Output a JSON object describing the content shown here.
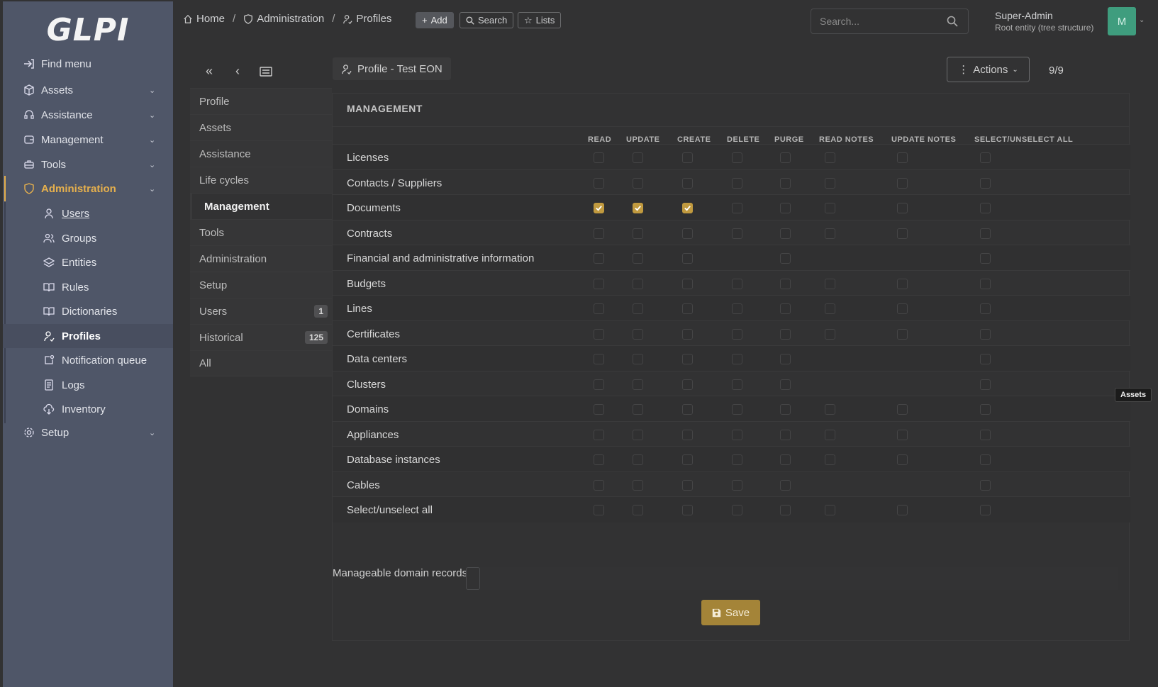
{
  "sidebar": {
    "logo": "GLPI",
    "items": [
      {
        "label": "Find menu",
        "icon": "find-menu-icon",
        "has_chevron": false
      },
      {
        "label": "Assets",
        "icon": "box-icon",
        "has_chevron": true
      },
      {
        "label": "Assistance",
        "icon": "headset-icon",
        "has_chevron": true
      },
      {
        "label": "Management",
        "icon": "wallet-icon",
        "has_chevron": true
      },
      {
        "label": "Tools",
        "icon": "briefcase-icon",
        "has_chevron": true
      },
      {
        "label": "Administration",
        "icon": "shield-icon",
        "has_chevron": true,
        "active": true
      }
    ],
    "admin_items": [
      {
        "label": "Users",
        "icon": "user-icon"
      },
      {
        "label": "Groups",
        "icon": "users-icon"
      },
      {
        "label": "Entities",
        "icon": "stack-icon"
      },
      {
        "label": "Rules",
        "icon": "book-icon"
      },
      {
        "label": "Dictionaries",
        "icon": "book-icon"
      },
      {
        "label": "Profiles",
        "icon": "user-check-icon",
        "active": true
      },
      {
        "label": "Notification queue",
        "icon": "notification-icon"
      },
      {
        "label": "Logs",
        "icon": "log-icon"
      },
      {
        "label": "Inventory",
        "icon": "cloud-download-icon"
      }
    ],
    "setup": {
      "label": "Setup",
      "icon": "gear-icon"
    }
  },
  "topbar": {
    "breadcrumbs": [
      "Home",
      "Administration",
      "Profiles"
    ],
    "add_label": "Add",
    "search_label": "Search",
    "lists_label": "Lists",
    "search_placeholder": "Search...",
    "user_name": "Super-Admin",
    "user_entity": "Root entity (tree structure)",
    "avatar_initial": "M"
  },
  "profile": {
    "title": "Profile - Test EON",
    "actions_label": "Actions",
    "pager": "9/9"
  },
  "tabs": [
    {
      "label": "Profile"
    },
    {
      "label": "Assets"
    },
    {
      "label": "Assistance"
    },
    {
      "label": "Life cycles"
    },
    {
      "label": "Management",
      "active": true
    },
    {
      "label": "Tools"
    },
    {
      "label": "Administration"
    },
    {
      "label": "Setup"
    },
    {
      "label": "Users",
      "badge": "1"
    },
    {
      "label": "Historical",
      "badge": "125"
    },
    {
      "label": "All"
    }
  ],
  "management": {
    "title": "MANAGEMENT",
    "columns": [
      "READ",
      "UPDATE",
      "CREATE",
      "DELETE",
      "PURGE",
      "READ NOTES",
      "UPDATE NOTES",
      "SELECT/UNSELECT ALL"
    ],
    "rows": [
      {
        "label": "Licenses",
        "cells": [
          0,
          0,
          0,
          0,
          0,
          0,
          0,
          0
        ]
      },
      {
        "label": "Contacts / Suppliers",
        "cells": [
          0,
          0,
          0,
          0,
          0,
          0,
          0,
          0
        ]
      },
      {
        "label": "Documents",
        "cells": [
          1,
          1,
          1,
          0,
          0,
          0,
          0,
          0
        ]
      },
      {
        "label": "Contracts",
        "cells": [
          0,
          0,
          0,
          0,
          0,
          0,
          0,
          0
        ]
      },
      {
        "label": "Financial and administrative information",
        "cells": [
          0,
          0,
          0,
          null,
          0,
          null,
          null,
          0
        ]
      },
      {
        "label": "Budgets",
        "cells": [
          0,
          0,
          0,
          0,
          0,
          0,
          0,
          0
        ]
      },
      {
        "label": "Lines",
        "cells": [
          0,
          0,
          0,
          0,
          0,
          0,
          0,
          0
        ]
      },
      {
        "label": "Certificates",
        "cells": [
          0,
          0,
          0,
          0,
          0,
          0,
          0,
          0
        ]
      },
      {
        "label": "Data centers",
        "cells": [
          0,
          0,
          0,
          0,
          0,
          null,
          null,
          0
        ]
      },
      {
        "label": "Clusters",
        "cells": [
          0,
          0,
          0,
          0,
          0,
          null,
          null,
          0
        ]
      },
      {
        "label": "Domains",
        "cells": [
          0,
          0,
          0,
          0,
          0,
          0,
          0,
          0
        ]
      },
      {
        "label": "Appliances",
        "cells": [
          0,
          0,
          0,
          0,
          0,
          0,
          0,
          0
        ]
      },
      {
        "label": "Database instances",
        "cells": [
          0,
          0,
          0,
          0,
          0,
          0,
          0,
          0
        ]
      },
      {
        "label": "Cables",
        "cells": [
          0,
          0,
          0,
          0,
          0,
          null,
          null,
          0
        ]
      },
      {
        "label": "Select/unselect all",
        "cells": [
          0,
          0,
          0,
          0,
          0,
          0,
          0,
          0
        ]
      }
    ],
    "domain_records_label": "Manageable domain records",
    "save_label": "Save"
  },
  "tooltip": "Assets"
}
